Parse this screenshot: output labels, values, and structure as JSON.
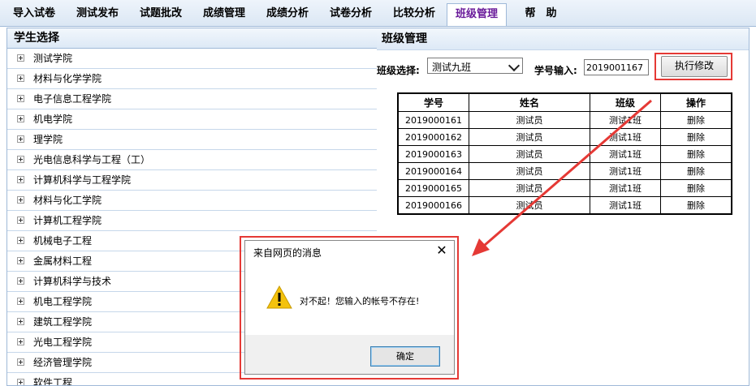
{
  "nav": {
    "tabs": [
      {
        "label": "导入试卷"
      },
      {
        "label": "测试发布"
      },
      {
        "label": "试题批改"
      },
      {
        "label": "成绩管理"
      },
      {
        "label": "成绩分析"
      },
      {
        "label": "试卷分析"
      },
      {
        "label": "比较分析"
      },
      {
        "label": "班级管理"
      },
      {
        "label": "帮　助"
      }
    ],
    "active_index": 7
  },
  "student_panel": {
    "title": "学生选择",
    "colleges": [
      {
        "label": "测试学院"
      },
      {
        "label": "材料与化学学院"
      },
      {
        "label": "电子信息工程学院"
      },
      {
        "label": "机电学院"
      },
      {
        "label": "理学院"
      },
      {
        "label": "光电信息科学与工程（工）"
      },
      {
        "label": "计算机科学与工程学院"
      },
      {
        "label": "材料与化工学院"
      },
      {
        "label": "计算机工程学院"
      },
      {
        "label": "机械电子工程"
      },
      {
        "label": "金属材料工程"
      },
      {
        "label": "计算机科学与技术"
      },
      {
        "label": "机电工程学院"
      },
      {
        "label": "建筑工程学院"
      },
      {
        "label": "光电工程学院"
      },
      {
        "label": "经济管理学院"
      },
      {
        "label": "软件工程"
      }
    ]
  },
  "class_panel": {
    "title": "班级管理",
    "class_select_label": "班级选择:",
    "class_select_value": "测试九班",
    "student_id_label": "学号输入:",
    "student_id_value": "2019001167",
    "execute_button": "执行修改",
    "table": {
      "headers": [
        "学号",
        "姓名",
        "班级",
        "操作"
      ],
      "rows": [
        [
          "2019000161",
          "测试员",
          "测试1班",
          "删除"
        ],
        [
          "2019000162",
          "测试员",
          "测试1班",
          "删除"
        ],
        [
          "2019000163",
          "测试员",
          "测试1班",
          "删除"
        ],
        [
          "2019000164",
          "测试员",
          "测试1班",
          "删除"
        ],
        [
          "2019000165",
          "测试员",
          "测试1班",
          "删除"
        ],
        [
          "2019000166",
          "测试员",
          "测试1班",
          "删除"
        ]
      ]
    }
  },
  "dialog": {
    "title": "来自网页的消息",
    "close_icon": "close-icon",
    "icon": "warning-icon",
    "message": "对不起！您输入的帐号不存在!",
    "ok_button": "确定"
  },
  "colors": {
    "highlight": "#e53935",
    "active_tab_text": "#6a1b9a",
    "panel_border": "#9fb9d8"
  }
}
